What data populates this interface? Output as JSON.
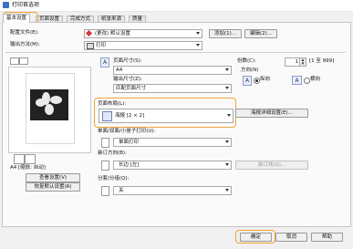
{
  "window": {
    "title": "打印首选项"
  },
  "tabs": [
    "基本设置",
    "页面设置",
    "完成方式",
    "纸张来源",
    "质量"
  ],
  "profile": {
    "label": "配置文件(E):",
    "value": "(更改) 默认设置",
    "add": "添加(1)...",
    "edit": "编辑(2)..."
  },
  "output": {
    "label": "输出方法(M):",
    "value": "打印"
  },
  "page_size": {
    "label": "页面尺寸(S):",
    "value": "A4"
  },
  "output_size": {
    "label": "输出尺寸(Z):",
    "value": "匹配页面尺寸"
  },
  "copies": {
    "label": "份数(C):",
    "value": "1",
    "range": "[1 至 999]"
  },
  "orientation": {
    "label": "方向(N)",
    "portrait": "纵向",
    "landscape": "横向",
    "selected": "portrait"
  },
  "layout": {
    "label": "页面布局(L):",
    "value": "海报 [2 × 2]",
    "detail_button": "海报详细设置(E)..."
  },
  "duplex": {
    "label": "单面/双面/小册子打印(U):",
    "value": "单面打印"
  },
  "binding": {
    "label": "装订方向(B):",
    "value": "长边 [左]",
    "margin_button": "装订线(G)..."
  },
  "collate": {
    "label": "分套/分组(Q):",
    "value": "关"
  },
  "preview": {
    "caption": "A4 [缩放: 自动]",
    "view_button": "查看设置(V)",
    "restore_button": "恢复默认设置(R)"
  },
  "footer": {
    "ok": "确定",
    "cancel": "取消",
    "help": "帮助"
  },
  "colors": {
    "highlight": "#f0a43a"
  }
}
